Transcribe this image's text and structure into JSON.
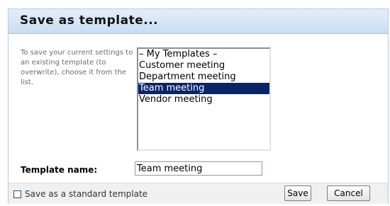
{
  "dialog": {
    "title": "Save as template...",
    "instructions": "To save your current settings to an existing template (to overwrite), choose it from the list."
  },
  "template_list": {
    "items": [
      {
        "label": "– My Templates –",
        "selected": false
      },
      {
        "label": "Customer meeting",
        "selected": false
      },
      {
        "label": "Department meeting",
        "selected": false
      },
      {
        "label": "Team meeting",
        "selected": true
      },
      {
        "label": "Vendor meeting",
        "selected": false
      }
    ]
  },
  "template_name": {
    "label": "Template name:",
    "value": "Team meeting"
  },
  "footer": {
    "standard_template_label": "Save as a standard template",
    "standard_template_checked": false,
    "save_label": "Save",
    "cancel_label": "Cancel"
  },
  "colors": {
    "title_bar": "#c9ddf4",
    "selection": "#0a246a",
    "footer": "#f0f0f0"
  }
}
